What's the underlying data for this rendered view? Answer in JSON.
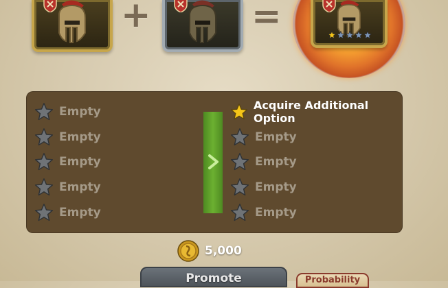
{
  "promotion": {
    "plus_symbol": "+",
    "equals_symbol": "=",
    "result_stars": {
      "filled": 1,
      "total": 5
    }
  },
  "options": {
    "current": [
      {
        "label": "Empty",
        "icon": "gray-star-icon"
      },
      {
        "label": "Empty",
        "icon": "gray-star-icon"
      },
      {
        "label": "Empty",
        "icon": "gray-star-icon"
      },
      {
        "label": "Empty",
        "icon": "gray-star-icon"
      },
      {
        "label": "Empty",
        "icon": "gray-star-icon"
      }
    ],
    "after": [
      {
        "label": "Acquire Additional Option",
        "icon": "gold-star-icon"
      },
      {
        "label": "Empty",
        "icon": "gray-star-icon"
      },
      {
        "label": "Empty",
        "icon": "gray-star-icon"
      },
      {
        "label": "Empty",
        "icon": "gray-star-icon"
      },
      {
        "label": "Empty",
        "icon": "gray-star-icon"
      }
    ]
  },
  "cost": {
    "amount": "5,000",
    "icon": "gold-coin-icon"
  },
  "buttons": {
    "promote": "Promote",
    "probability": "Probability"
  },
  "colors": {
    "panel": "#5f4a2e",
    "arrow_band": "#6bb031",
    "star_gold": "#f5c518",
    "star_gray": "#6f7377"
  }
}
